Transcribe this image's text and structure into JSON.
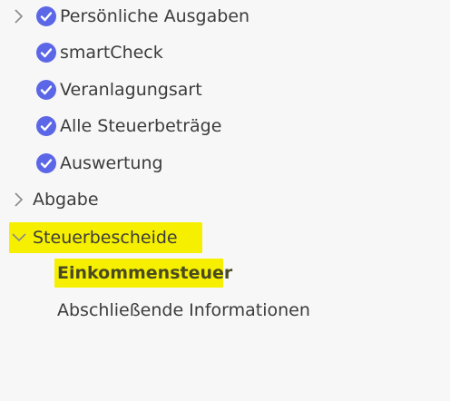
{
  "nav": {
    "section_prev": {
      "label": "Persönliche Ausgaben",
      "icon": "chevron-right-icon",
      "status_icon": "check-circle-icon"
    },
    "items_done": [
      {
        "label": "smartCheck",
        "status_icon": "check-circle-icon"
      },
      {
        "label": "Veranlagungsart",
        "status_icon": "check-circle-icon"
      },
      {
        "label": "Alle Steuerbeträge",
        "status_icon": "check-circle-icon"
      },
      {
        "label": "Auswertung",
        "status_icon": "check-circle-icon"
      }
    ],
    "abgabe": {
      "label": "Abgabe",
      "icon": "chevron-right-icon"
    },
    "steuerbescheide": {
      "label": "Steuerbescheide",
      "icon": "chevron-down-icon",
      "expanded": true,
      "highlighted": true,
      "children": [
        {
          "label": "Einkommensteuer",
          "active": true,
          "highlighted": true
        },
        {
          "label": "Abschließende Informationen",
          "active": false
        }
      ]
    }
  },
  "colors": {
    "check": "#5b67e6",
    "highlight": "#f6f000",
    "text": "#3c3c3c",
    "chevron": "#8a8a8a",
    "background": "#f8f7f8"
  }
}
